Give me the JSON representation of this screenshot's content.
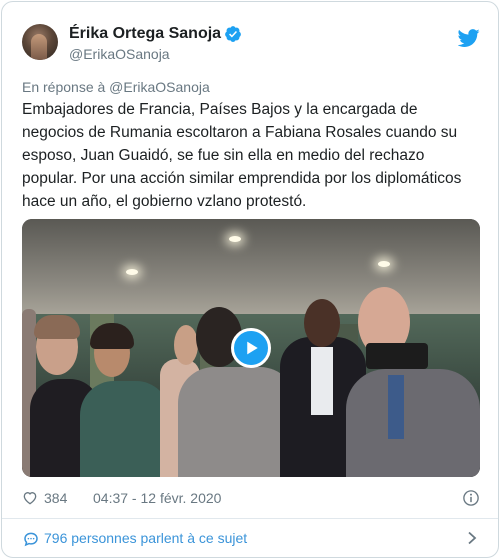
{
  "author": {
    "name": "Érika Ortega Sanoja",
    "handle": "@ErikaOSanoja",
    "verified": true
  },
  "reply_context": "En réponse à @ErikaOSanoja",
  "tweet": {
    "lines": [
      "Embajadores de Francia, Países Bajos y la encargada de",
      "negocios de Rumania escoltaron a Fabiana Rosales cuando su",
      "esposo, Juan Guaidó, se fue sin ella en medio del rechazo",
      "popular. Por una acción similar emprendida por los diplomáticos",
      "hace un año, el gobierno vzlano protestó."
    ]
  },
  "media": {
    "type": "video",
    "play_icon": "play-icon"
  },
  "meta": {
    "likes": "384",
    "timestamp": "04:37 - 12 févr. 2020"
  },
  "footer": {
    "text": "796 personnes parlent à ce sujet"
  },
  "colors": {
    "brand": "#1da1f2",
    "secondary_text": "#697882",
    "link": "#3b94d9",
    "text": "#1c2022"
  },
  "icons": [
    "verified-badge-icon",
    "twitter-bird-icon",
    "heart-icon",
    "info-icon",
    "comment-icon",
    "chevron-right-icon",
    "play-icon"
  ]
}
